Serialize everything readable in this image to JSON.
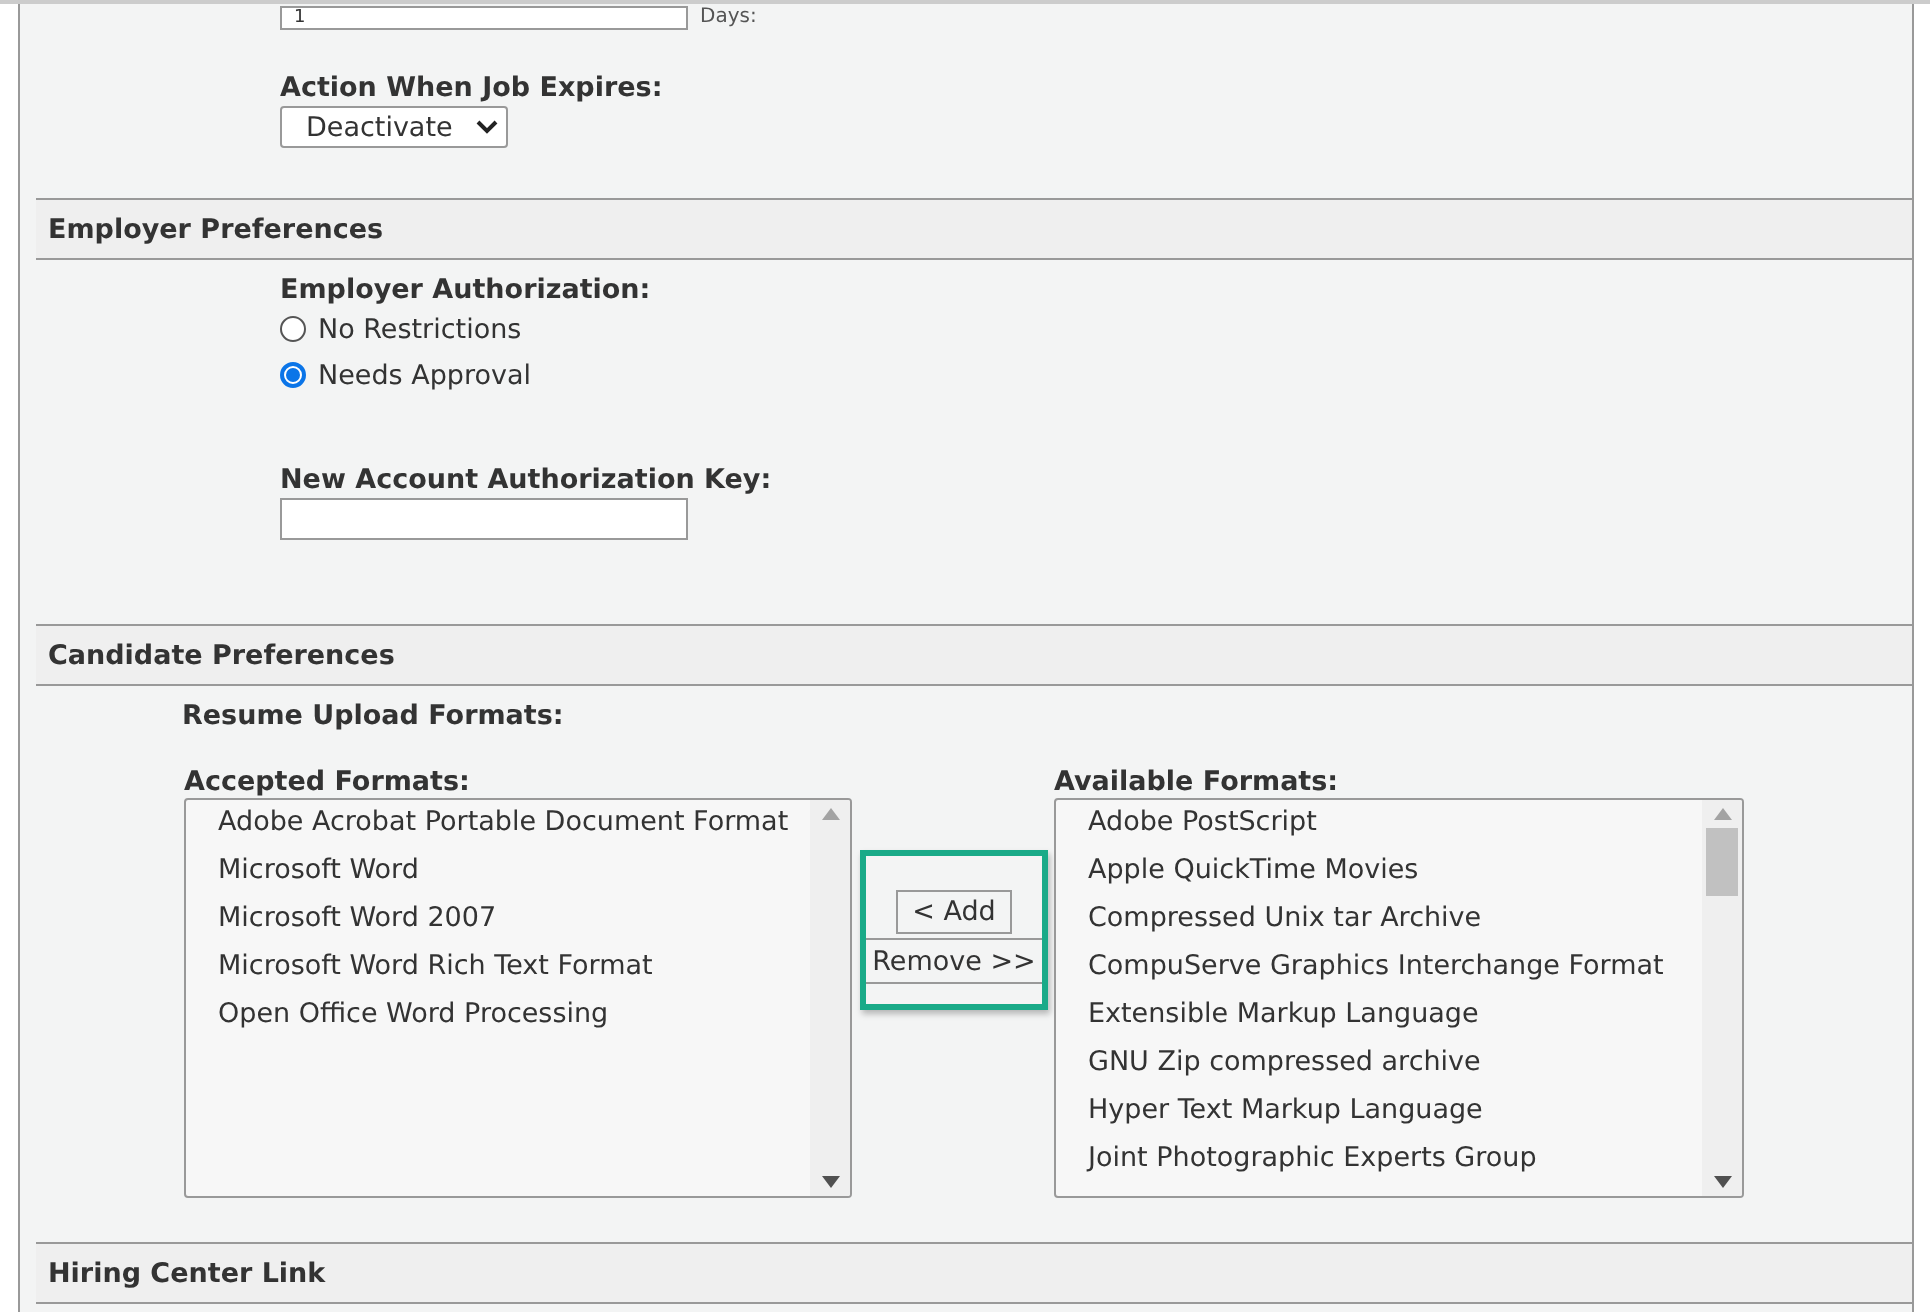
{
  "expiration": {
    "value": "1",
    "unit": "Days:"
  },
  "job_expiry": {
    "label": "Action When Job Expires:",
    "value": "Deactivate"
  },
  "employer_preferences": {
    "title": "Employer Preferences",
    "authorization": {
      "label": "Employer Authorization:",
      "options": [
        {
          "label": "No Restrictions",
          "selected": false
        },
        {
          "label": "Needs Approval",
          "selected": true
        }
      ]
    },
    "key": {
      "label": "New Account Authorization Key:"
    }
  },
  "candidate_preferences": {
    "title": "Candidate Preferences",
    "resume_label": "Resume Upload Formats:",
    "accepted": {
      "label": "Accepted Formats:",
      "items": [
        "Adobe Acrobat Portable Document Format",
        "Microsoft Word",
        "Microsoft Word 2007",
        "Microsoft Word Rich Text Format",
        "Open Office Word Processing"
      ]
    },
    "buttons": [
      "< Add",
      "Remove >>"
    ],
    "available": {
      "label": "Available Formats:",
      "items": [
        "Adobe PostScript",
        "Apple QuickTime Movies",
        "Compressed Unix tar Archive",
        "CompuServe Graphics Interchange Format",
        "Extensible Markup Language",
        "GNU Zip compressed archive",
        "Hyper Text Markup Language",
        "Joint Photographic Experts Group"
      ]
    }
  },
  "hiring_center": {
    "title": "Hiring Center Link"
  }
}
